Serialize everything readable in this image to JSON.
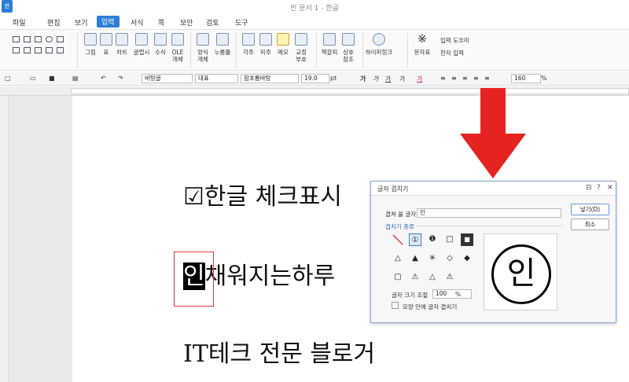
{
  "app": {
    "logo_text": "한",
    "title": "빈 문서 1 - 한글"
  },
  "menu": {
    "items": [
      "파일",
      "편집",
      "보기",
      "입력",
      "서식",
      "쪽",
      "보안",
      "검토",
      "도구"
    ],
    "active": "입력"
  },
  "ribbon": {
    "items": [
      {
        "label": "그림",
        "icon": "image-icon"
      },
      {
        "label": "표",
        "icon": "table-icon"
      },
      {
        "label": "차트",
        "icon": "chart-icon"
      },
      {
        "label": "글맵시",
        "icon": "wordart-icon"
      },
      {
        "label": "수식",
        "icon": "formula-icon"
      },
      {
        "label": "OLE\n개체",
        "icon": "ole-icon"
      },
      {
        "label": "양식\n개체",
        "icon": "form-icon"
      },
      {
        "label": "누름틀",
        "icon": "field-icon"
      },
      {
        "label": "각주",
        "icon": "footnote-icon"
      },
      {
        "label": "미주",
        "icon": "endnote-icon"
      },
      {
        "label": "메모",
        "icon": "memo-icon"
      },
      {
        "label": "교정\n부호",
        "icon": "proof-icon"
      },
      {
        "label": "책갈피",
        "icon": "bookmark-icon"
      },
      {
        "label": "상호\n참조",
        "icon": "crossref-icon"
      },
      {
        "label": "하이퍼링크",
        "icon": "hyperlink-icon"
      },
      {
        "label": "문자표",
        "icon": "symbol-icon"
      }
    ],
    "side_items": [
      "입력 도우미",
      "한자 입력"
    ]
  },
  "format_bar": {
    "style": "바탕글",
    "lang": "대표",
    "font": "함초롬바탕",
    "size": "19.0",
    "size_unit": "pt",
    "zoom": "160",
    "zoom_unit": "%"
  },
  "document": {
    "line1": "☑한글 체크표시",
    "line2_highlight": "인",
    "line2_rest": "채워지는하루",
    "line3": "IT테크 전문 블로거"
  },
  "dialog": {
    "title": "글자 겹치기",
    "char_label": "겹쳐 쓸 글자",
    "char_value": "인",
    "kind_label": "겹치기 종류",
    "size_label": "글자 크기 조절",
    "size_value": "100",
    "size_unit": "%",
    "inside_label": "모양 안에 글자 겹치기",
    "ok_label": "넣기(D)",
    "cancel_label": "취소",
    "preview_char": "인"
  },
  "colors": {
    "accent": "#2d7fd6",
    "highlight_border": "#e23a3a",
    "arrow": "#e52421"
  }
}
